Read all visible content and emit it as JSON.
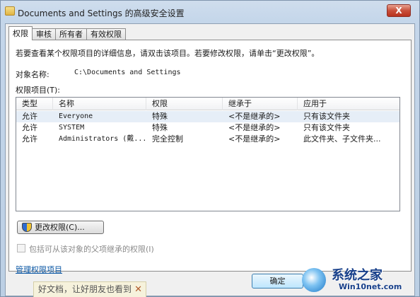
{
  "window": {
    "title": "Documents and Settings 的高级安全设置",
    "close_glyph": "X",
    "folder_icon": "folder-icon"
  },
  "tabs": [
    {
      "label": "权限",
      "active": true
    },
    {
      "label": "审核",
      "active": false
    },
    {
      "label": "所有者",
      "active": false
    },
    {
      "label": "有效权限",
      "active": false
    }
  ],
  "permissions_tab": {
    "intro": "若要查看某个权限项目的详细信息，请双击该项目。若要修改权限，请单击“更改权限”。",
    "object_name_label": "对象名称:",
    "object_name_value": "C:\\Documents and Settings",
    "entries_label": "权限项目(T):",
    "columns": [
      "类型",
      "名称",
      "权限",
      "继承于",
      "应用于"
    ],
    "rows": [
      {
        "type": "允许",
        "name": "Everyone",
        "permission": "特殊",
        "inherited_from": "<不是继承的>",
        "applies_to": "只有该文件夹"
      },
      {
        "type": "允许",
        "name": "SYSTEM",
        "permission": "特殊",
        "inherited_from": "<不是继承的>",
        "applies_to": "只有该文件夹"
      },
      {
        "type": "允许",
        "name": "Administrators (戴...",
        "permission": "完全控制",
        "inherited_from": "<不是继承的>",
        "applies_to": "此文件夹、子文件夹..."
      }
    ],
    "change_button": "更改权限(C)...",
    "change_button_icon": "uac-shield-icon",
    "inherit_checkbox_label": "包括可从该对象的父项继承的权限(I)",
    "inherit_checked": false,
    "manage_link": "管理权限项目"
  },
  "footer": {
    "ok_button": "确定"
  },
  "overlay_banner": {
    "text": "好文档，让好朋友也看到",
    "close_glyph": "✕"
  },
  "watermark": {
    "main": "系统之家",
    "sub": "Win10net.com"
  }
}
